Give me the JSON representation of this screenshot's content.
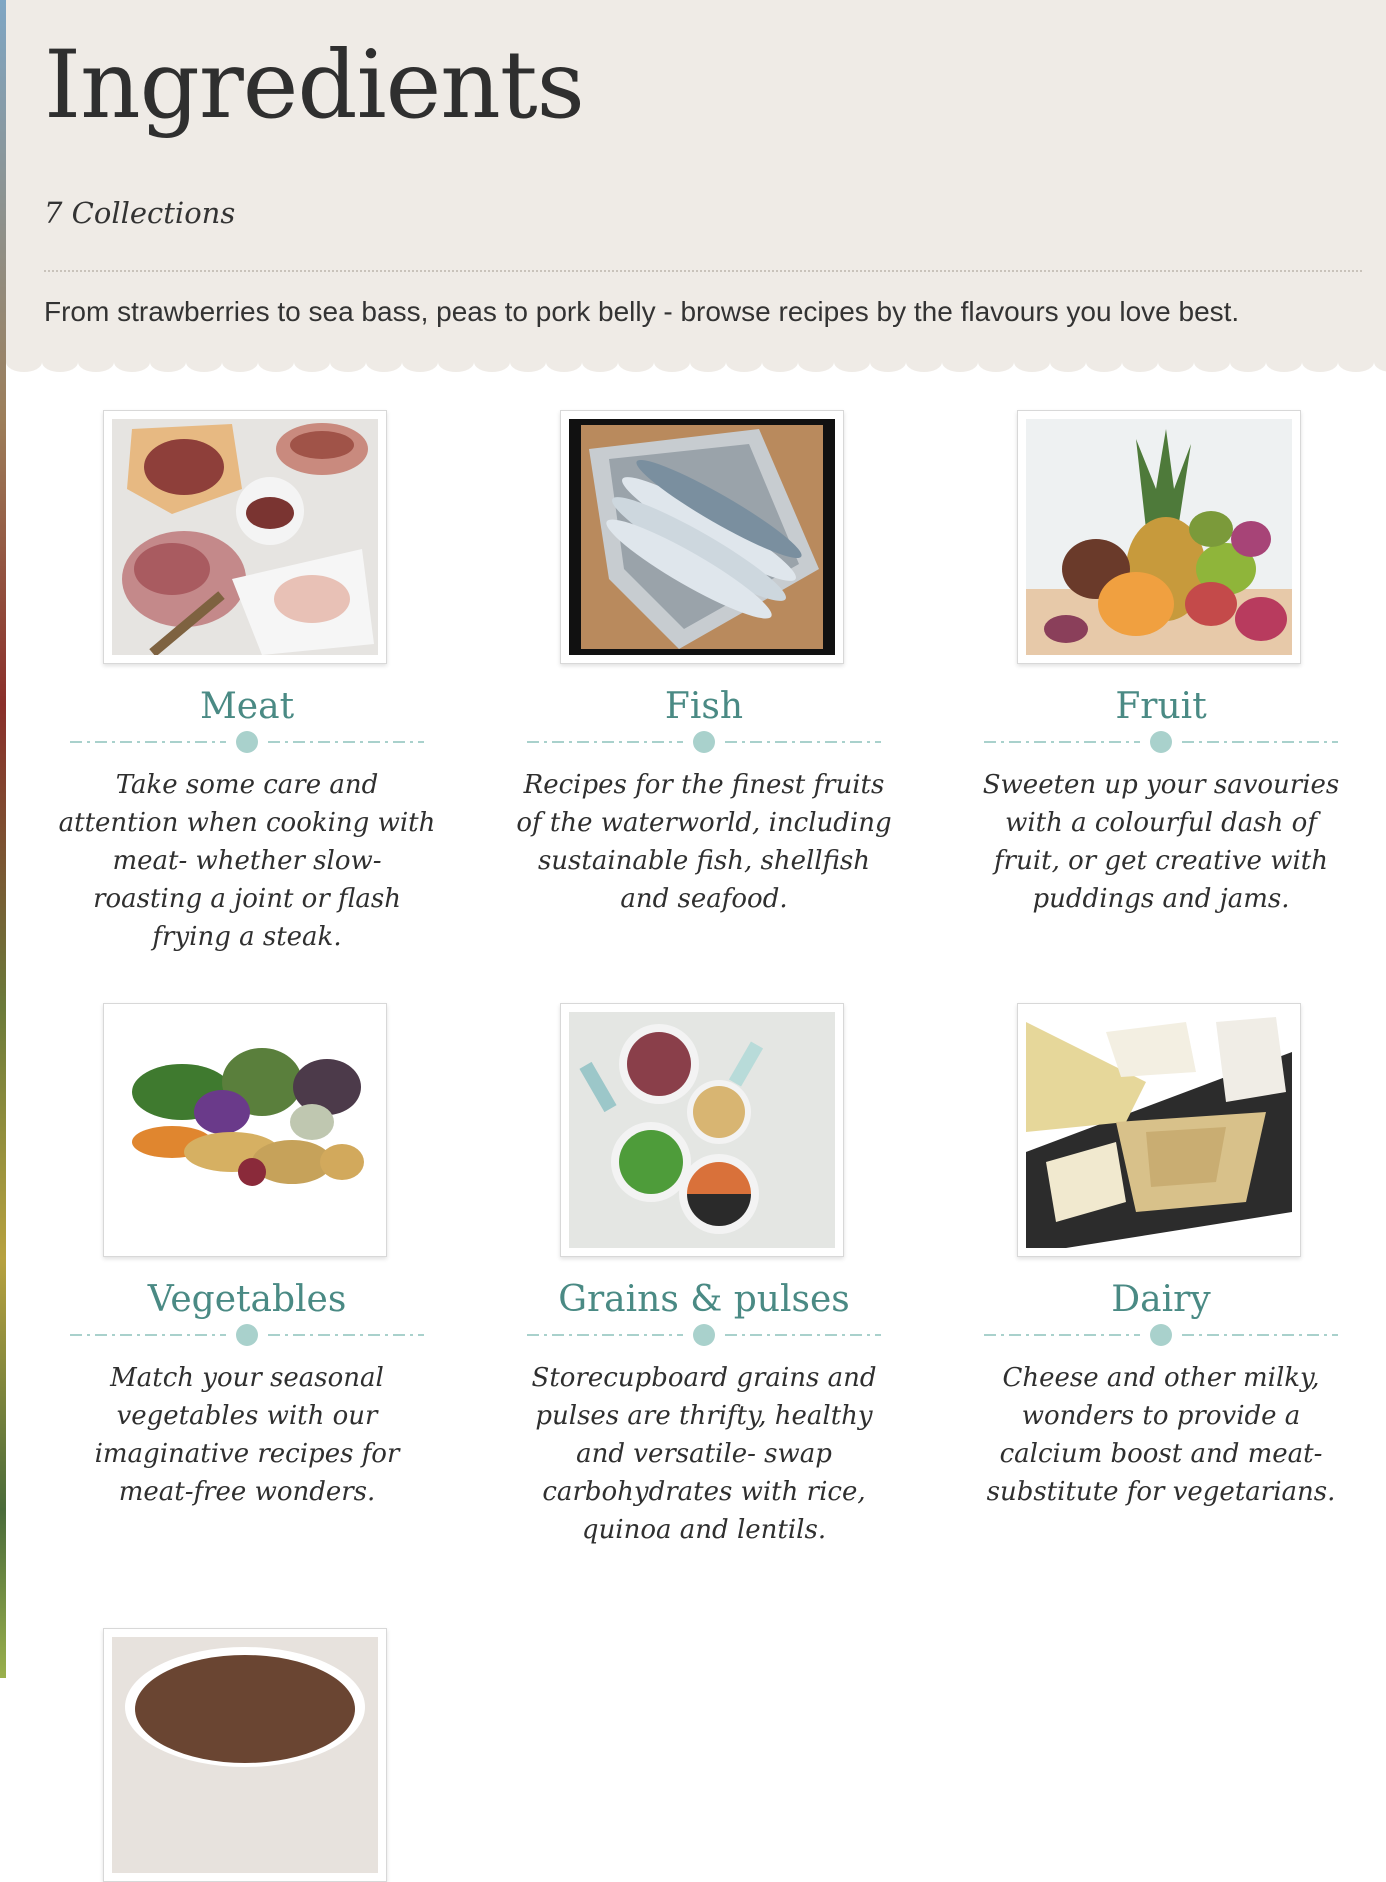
{
  "header": {
    "title": "Ingredients",
    "collections": "7 Collections",
    "intro": "From strawberries to sea bass, peas to pork belly - browse recipes by the flavours you love best."
  },
  "colors": {
    "header_bg": "#efebe6",
    "accent": "#4a8a84",
    "divider": "#a9d1cc"
  },
  "cards": [
    {
      "title": "Meat",
      "description": "Take some care and attention when cooking with meat- whether slow-roasting a joint or flash frying a steak.",
      "icon": "meat-photo"
    },
    {
      "title": "Fish",
      "description": "Recipes for the finest fruits of the waterworld, including sustainable fish, shellfish and seafood.",
      "icon": "fish-photo"
    },
    {
      "title": "Fruit",
      "description": "Sweeten up your savouries with a colourful dash of fruit, or get creative with puddings and jams.",
      "icon": "fruit-photo"
    },
    {
      "title": "Vegetables",
      "description": "Match your seasonal vegetables with our imaginative recipes for meat-free wonders.",
      "icon": "vegetables-photo"
    },
    {
      "title": "Grains & pulses",
      "description": "Storecupboard grains and pulses are thrifty, healthy and versatile- swap carbohydrates with rice, quinoa and lentils.",
      "icon": "grains-photo"
    },
    {
      "title": "Dairy",
      "description": "Cheese and other milky, wonders to provide a calcium boost and meat-substitute for vegetarians.",
      "icon": "dairy-photo"
    }
  ]
}
